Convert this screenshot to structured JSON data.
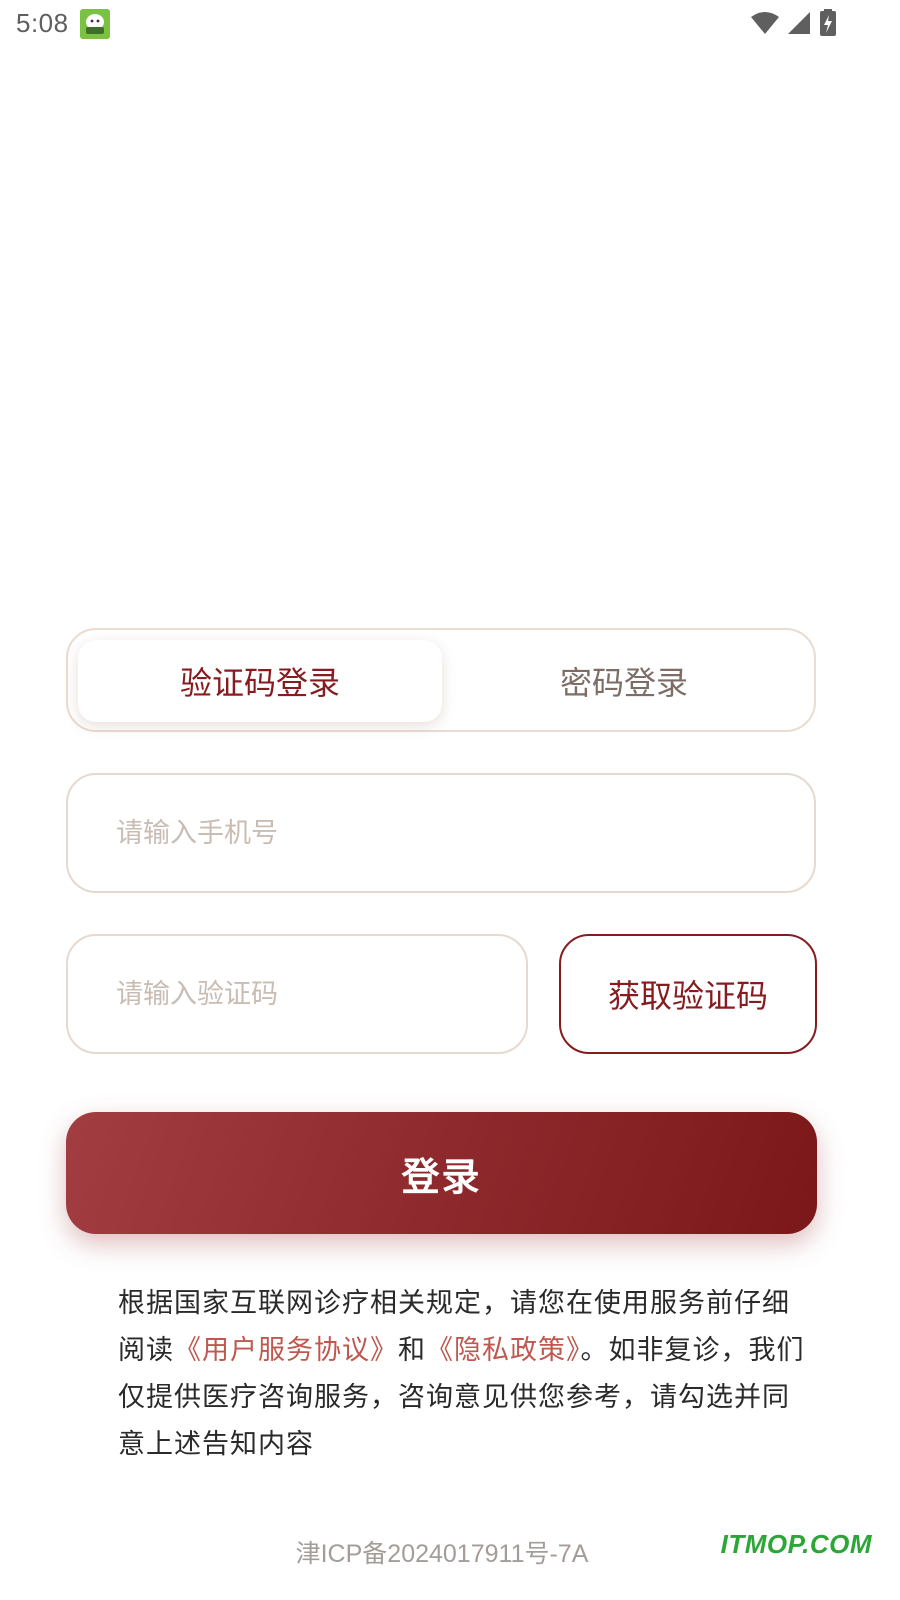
{
  "status_bar": {
    "time": "5:08",
    "icons": [
      "app-notification-icon",
      "wifi-icon",
      "cell-signal-icon",
      "battery-charging-icon"
    ]
  },
  "login_tabs": {
    "sms_tab_label": "验证码登录",
    "password_tab_label": "密码登录",
    "active": "sms"
  },
  "form": {
    "phone_placeholder": "请输入手机号",
    "code_placeholder": "请输入验证码",
    "get_code_label": "获取验证码",
    "login_label": "登录"
  },
  "notice": {
    "part1": "根据国家互联网诊疗相关规定，请您在使用服务前仔细阅读",
    "user_agreement_link": "《用户服务协议》",
    "and": "和",
    "privacy_link": "《隐私政策》",
    "part2": "。如非复诊，我们仅提供医疗咨询服务，咨询意见供您参考，请勾选并同意上述告知内容"
  },
  "footer": {
    "icp": "津ICP备2024017911号-7A",
    "watermark": "ITMOP.COM"
  },
  "colors": {
    "brand": "#861c1f",
    "link": "#c0584f",
    "border": "#e6d9ce"
  }
}
